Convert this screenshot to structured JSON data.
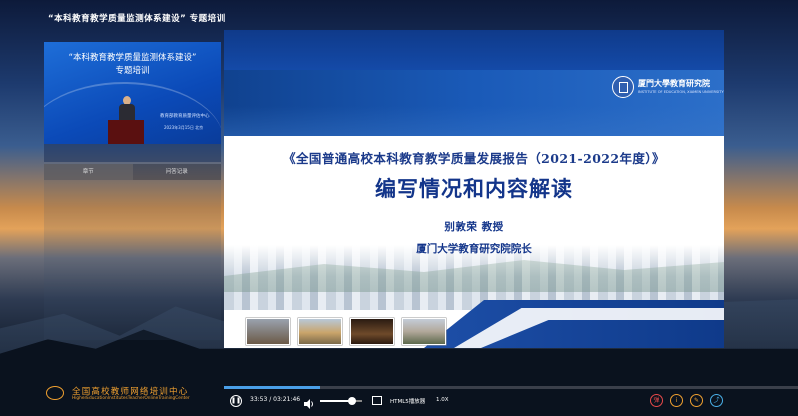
{
  "page": {
    "top_title": "“本科教育教学质量监测体系建设” 专题培训"
  },
  "left_video": {
    "title_line1": "“本科教育教学质量监测体系建设”",
    "title_line2": "专题培训",
    "sub1": "教育部教育质量评估中心",
    "sub2": "2023年3月15日 北京"
  },
  "tabs": [
    {
      "label": "章节"
    },
    {
      "label": "问答记录"
    }
  ],
  "slide": {
    "logo_name": "厦門大學教育研究院",
    "logo_sub": "INSTITUTE OF EDUCATION, XIAMEN UNIVERSITY",
    "title1": "《全国普通高校本科教育教学质量发展报告（2021-2022年度）》",
    "title2": "编写情况和内容解读",
    "author": "别敦荣   教授",
    "org": "厦门大学教育研究院院长"
  },
  "footer": {
    "logo_name": "全国高校教师网络培训中心",
    "logo_en": "HigherEducationInstitutesTeacherOnlineTrainingCenter"
  },
  "player": {
    "time": "33:53 / 03:21:46",
    "progress": 0.168,
    "volume": 0.76,
    "player_name": "HTML5播放器",
    "speed": "1.0X"
  },
  "colors": {
    "accent": "#f0a030",
    "slide_blue": "#13358a",
    "progress": "#4a9fe8"
  }
}
